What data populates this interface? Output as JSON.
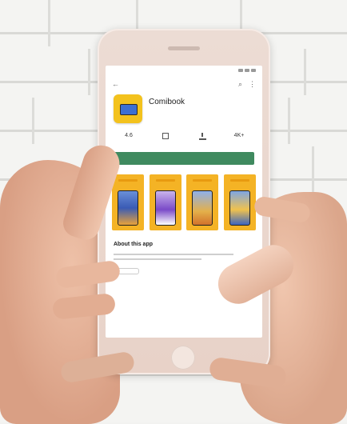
{
  "app": {
    "name": "Comibook",
    "developer": "",
    "icon": "comic-book-icon",
    "accent_color": "#3f8a5f",
    "icon_color": "#f3c21d"
  },
  "toolbar": {
    "back_icon": "arrow-left-icon",
    "search_icon": "search-icon",
    "more_icon": "more-vert-icon"
  },
  "stats": [
    {
      "value": "4.6",
      "label": "",
      "icon": "star-icon"
    },
    {
      "value": "",
      "label": "",
      "icon": "content-rating-icon"
    },
    {
      "value": "",
      "label": "",
      "icon": "download-size-icon"
    },
    {
      "value": "4K+",
      "label": "",
      "icon": "downloads-icon"
    }
  ],
  "install_label": "",
  "about": {
    "title": "About this app"
  }
}
